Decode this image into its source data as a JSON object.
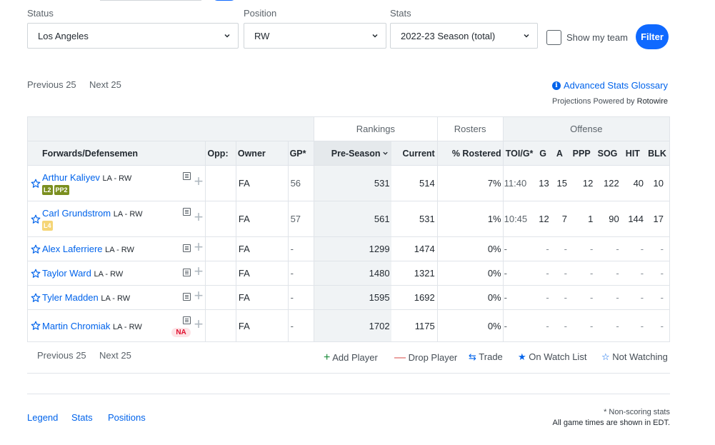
{
  "filters": {
    "status_label": "Status",
    "status_value": "Los Angeles",
    "position_label": "Position",
    "position_value": "RW",
    "stats_label": "Stats",
    "stats_value": "2022-23 Season (total)",
    "show_my_team": "Show my team",
    "filter_button": "Filter"
  },
  "pager_top": {
    "prev": "Previous 25",
    "next": "Next 25"
  },
  "pager_bottom": {
    "prev": "Previous 25",
    "next": "Next 25"
  },
  "glossary": "Advanced Stats Glossary",
  "projections": {
    "prefix": "Projections Powered by ",
    "brand": "Rotowire"
  },
  "table": {
    "groups": {
      "rankings": "Rankings",
      "rosters": "Rosters",
      "offense": "Offense"
    },
    "headers": {
      "player": "Forwards/Defensemen",
      "opp": "Opp:",
      "owner": "Owner",
      "gp": "GP*",
      "preseason": "Pre-Season",
      "current": "Current",
      "rostered": "% Rostered",
      "toi": "TOI/G*",
      "g": "G",
      "a": "A",
      "ppp": "PPP",
      "sog": "SOG",
      "hit": "HIT",
      "blk": "BLK"
    },
    "rows": [
      {
        "name": "Arthur Kaliyev",
        "pos": "LA - RW",
        "tags": [
          "L2",
          "PP2"
        ],
        "tag_style": "green",
        "owner": "FA",
        "gp": "56",
        "preseason": "531",
        "current": "514",
        "rostered": "7%",
        "toi": "11:40",
        "g": "13",
        "a": "15",
        "ppp": "12",
        "sog": "122",
        "hit": "40",
        "blk": "10"
      },
      {
        "name": "Carl Grundstrom",
        "pos": "LA - RW",
        "tags": [
          "L4"
        ],
        "tag_style": "yellow",
        "owner": "FA",
        "gp": "57",
        "preseason": "561",
        "current": "531",
        "rostered": "1%",
        "toi": "10:45",
        "g": "12",
        "a": "7",
        "ppp": "1",
        "sog": "90",
        "hit": "144",
        "blk": "17"
      },
      {
        "name": "Alex Laferriere",
        "pos": "LA - RW",
        "tags": [],
        "owner": "FA",
        "gp": "-",
        "preseason": "1299",
        "current": "1474",
        "rostered": "0%",
        "toi": "-",
        "g": "-",
        "a": "-",
        "ppp": "-",
        "sog": "-",
        "hit": "-",
        "blk": "-"
      },
      {
        "name": "Taylor Ward",
        "pos": "LA - RW",
        "tags": [],
        "owner": "FA",
        "gp": "-",
        "preseason": "1480",
        "current": "1321",
        "rostered": "0%",
        "toi": "-",
        "g": "-",
        "a": "-",
        "ppp": "-",
        "sog": "-",
        "hit": "-",
        "blk": "-"
      },
      {
        "name": "Tyler Madden",
        "pos": "LA - RW",
        "tags": [],
        "owner": "FA",
        "gp": "-",
        "preseason": "1595",
        "current": "1692",
        "rostered": "0%",
        "toi": "-",
        "g": "-",
        "a": "-",
        "ppp": "-",
        "sog": "-",
        "hit": "-",
        "blk": "-"
      },
      {
        "name": "Martin Chromiak",
        "pos": "LA - RW",
        "tags": [],
        "badge": "NA",
        "owner": "FA",
        "gp": "-",
        "preseason": "1702",
        "current": "1175",
        "rostered": "0%",
        "toi": "-",
        "g": "-",
        "a": "-",
        "ppp": "-",
        "sog": "-",
        "hit": "-",
        "blk": "-"
      }
    ]
  },
  "legend": {
    "add": "Add Player",
    "drop": "Drop Player",
    "trade": "Trade",
    "on_watch": "On Watch List",
    "not_watching": "Not Watching"
  },
  "footer": {
    "links": [
      "Legend",
      "Stats",
      "Positions"
    ],
    "note1": "* Non-scoring stats",
    "note2": "All game times are shown in EDT."
  },
  "colors": {
    "accent": "#0f69ff",
    "link": "#0063eb",
    "tag_green": "#7b8f1f",
    "tag_yellow": "#f5d576",
    "na_red": "#e0102f"
  }
}
